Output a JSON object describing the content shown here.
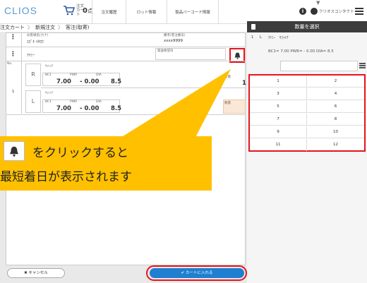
{
  "header": {
    "logo": "CLIOS",
    "cart_label": "注文カート",
    "cart_count": "0",
    "cart_unit": "点",
    "nav": [
      "注文履歴",
      "ロット情報",
      "製品バーコード情報"
    ],
    "user": "クリオスコンタクト"
  },
  "breadcrumb": [
    "注文カート",
    "新規注文",
    "客注(取寄)"
  ],
  "order": {
    "customer_label": "お客様名(カナ)",
    "customer_value": "ｽｽﾞｷ ｲﾁﾛｳ",
    "memo_label": "備考(客注番号)",
    "memo_value": "xxxx9999",
    "row_no_label": "No.",
    "row_no": "1",
    "product": "ｱｲﾐｰ",
    "ship_label": "発送希望日",
    "right": {
      "eye": "R",
      "design": "ｻﾌｧｲｱ",
      "bc_label": "BC1",
      "pwr_label": "PWR",
      "dia_label": "DIA",
      "bc": "7.00",
      "pwr": "- 0.00",
      "dia": "8.5",
      "qty_label": "数量",
      "qty": "1"
    },
    "left": {
      "eye": "L",
      "design": "ｻﾌｧｲｱ",
      "bc_label": "BC1",
      "pwr_label": "PWR",
      "dia_label": "DIA",
      "bc": "7.00",
      "pwr": "- 0.00",
      "dia": "8.5",
      "qty_label": "数量"
    }
  },
  "panel": {
    "title": "数量を選択",
    "line_no": "1",
    "line_eye": "L",
    "line_product": "ｱｲﾐｰ",
    "line_design": "ｻﾌｧｲｱ",
    "spec": "BC1= 7.00 PWR= - 0.00 DIA= 8.5",
    "quantities": [
      "1",
      "2",
      "3",
      "4",
      "5",
      "6",
      "7",
      "8",
      "9",
      "10",
      "11",
      "12"
    ]
  },
  "callout": {
    "line1": "をクリックすると",
    "line2": "最短着日が表示されます"
  },
  "buttons": {
    "cancel": "キャンセル",
    "add_to_cart": "カートに入れる"
  },
  "colors": {
    "highlight": "#e8141b",
    "callout": "#ffc000",
    "primary": "#1f7fd0"
  }
}
